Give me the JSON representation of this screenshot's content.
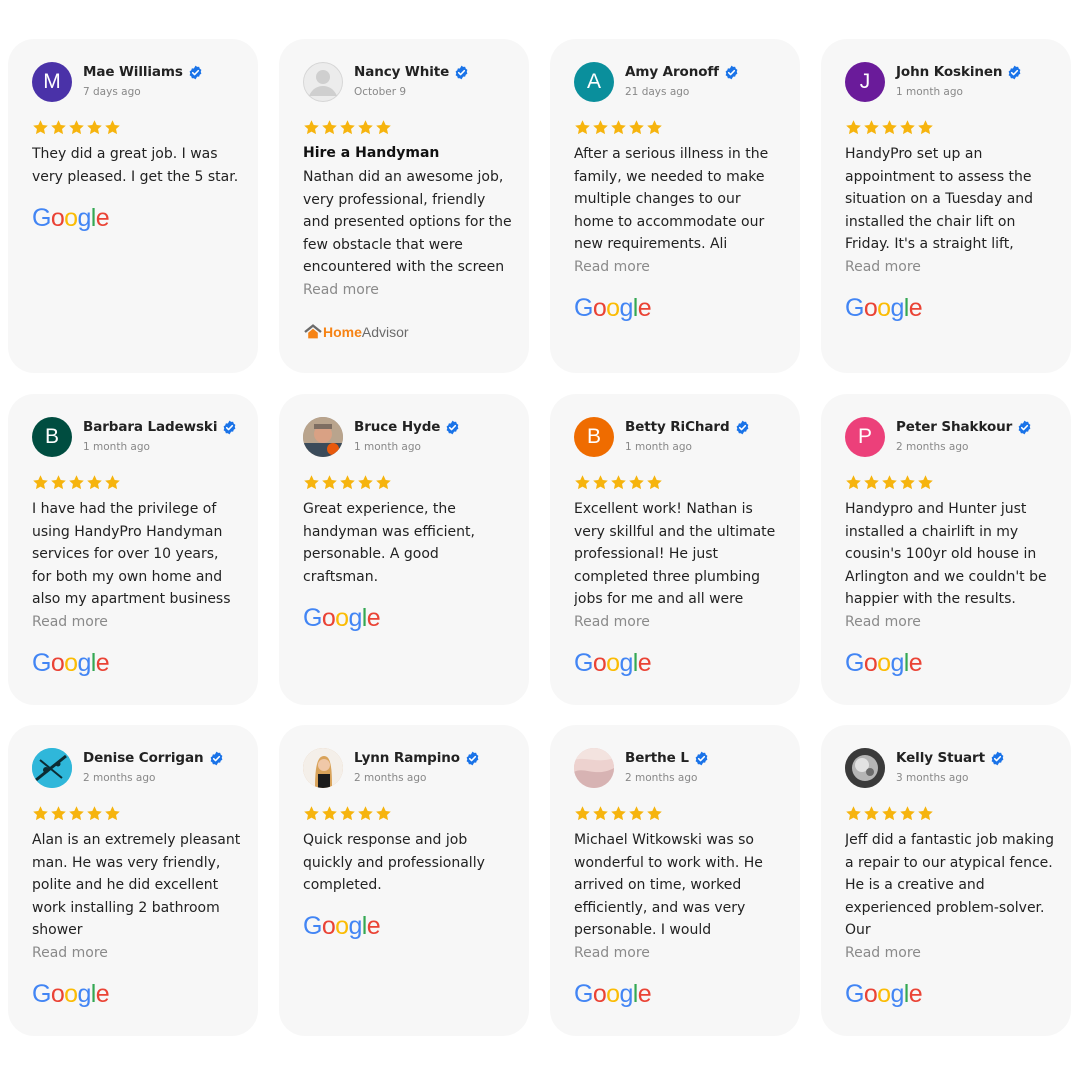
{
  "reviews": [
    {
      "name": "Mae Williams",
      "date": "7 days ago",
      "initial": "M",
      "avatar_color": "#4a32a8",
      "rating": 5,
      "title": "",
      "text": "They did a great job. I was very pleased. I get the 5 star.",
      "read_more": "",
      "source": "Google",
      "avatar_type": "letter"
    },
    {
      "name": "Nancy White",
      "date": "October 9",
      "initial": "",
      "avatar_color": "#e6e6e6",
      "rating": 5,
      "title": "Hire a Handyman",
      "text": "Nathan did an awesome job, very professional, friendly and presented options for the few obstacle that were encountered with the screen",
      "read_more": "Read more",
      "source": "HomeAdvisor",
      "avatar_type": "placeholder",
      "source_parts": [
        "Home",
        "Advisor"
      ]
    },
    {
      "name": "Amy Aronoff",
      "date": "21 days ago",
      "initial": "A",
      "avatar_color": "#0a8f9c",
      "rating": 5,
      "title": "",
      "text": "After a serious illness in the family, we needed to make multiple changes to our home to accommodate our new requirements. Ali",
      "read_more": "Read more",
      "source": "Google",
      "avatar_type": "letter"
    },
    {
      "name": "John Koskinen",
      "date": "1 month ago",
      "initial": "J",
      "avatar_color": "#6a1b9a",
      "rating": 5,
      "title": "",
      "text": "HandyPro set up an appointment to assess the situation on a Tuesday and installed the chair lift on Friday. It's a straight lift,",
      "read_more": "Read more",
      "source": "Google",
      "avatar_type": "letter"
    },
    {
      "name": "Barbara Ladewski",
      "date": "1 month ago",
      "initial": "B",
      "avatar_color": "#004d40",
      "rating": 5,
      "title": "",
      "text": "I have had the privilege of using HandyPro Handyman services for over 10 years, for both my own home and also my apartment business",
      "read_more": "Read more",
      "source": "Google",
      "avatar_type": "letter"
    },
    {
      "name": "Bruce Hyde",
      "date": "1 month ago",
      "initial": "",
      "avatar_color": "#8a7a6a",
      "rating": 5,
      "title": "",
      "text": "Great experience, the handyman was efficient, personable. A good craftsman.",
      "read_more": "",
      "source": "Google",
      "avatar_type": "photo"
    },
    {
      "name": "Betty RiChard",
      "date": "1 month ago",
      "initial": "B",
      "avatar_color": "#ef6c00",
      "rating": 5,
      "title": "",
      "text": "Excellent work! Nathan is very skillful and the ultimate professional! He just completed three plumbing jobs for me and all were",
      "read_more": "Read more",
      "source": "Google",
      "avatar_type": "letter"
    },
    {
      "name": "Peter Shakkour",
      "date": "2 months ago",
      "initial": "P",
      "avatar_color": "#ec407a",
      "rating": 5,
      "title": "",
      "text": "Handypro and Hunter just installed a chairlift in my cousin's 100yr old house in Arlington and we couldn't be happier with the results.",
      "read_more": "Read more",
      "source": "Google",
      "avatar_type": "letter"
    },
    {
      "name": "Denise Corrigan",
      "date": "2 months ago",
      "initial": "",
      "avatar_color": "#29b6d8",
      "rating": 5,
      "title": "",
      "text": "Alan is an extremely pleasant man. He was very friendly, polite and he did excellent work installing 2 bathroom shower",
      "read_more": "Read more",
      "source": "Google",
      "avatar_type": "photo"
    },
    {
      "name": "Lynn Rampino",
      "date": "2 months ago",
      "initial": "",
      "avatar_color": "#d9b38c",
      "rating": 5,
      "title": "",
      "text": "Quick response and job quickly and professionally completed.",
      "read_more": "",
      "source": "Google",
      "avatar_type": "photo"
    },
    {
      "name": "Berthe L",
      "date": "2 months ago",
      "initial": "",
      "avatar_color": "#e7c3c3",
      "rating": 5,
      "title": "",
      "text": "Michael Witkowski was so wonderful to work with. He arrived on time, worked efficiently, and was very personable. I would",
      "read_more": "Read more",
      "source": "Google",
      "avatar_type": "photo"
    },
    {
      "name": "Kelly Stuart",
      "date": "3 months ago",
      "initial": "",
      "avatar_color": "#9e9e9e",
      "rating": 5,
      "title": "",
      "text": "Jeff did a fantastic job making a repair to our atypical fence. He is a creative and experienced problem-solver. Our",
      "read_more": "Read more",
      "source": "Google",
      "avatar_type": "photo"
    }
  ],
  "google_letters": [
    "G",
    "o",
    "o",
    "g",
    "l",
    "e"
  ],
  "colors": {
    "star": "#f6b40e",
    "verified": "#1a73e8",
    "card_bg": "#f7f7f7"
  },
  "icons": {
    "star": "star-icon",
    "verified": "verified-badge-icon",
    "google": "google-logo",
    "homeadvisor": "homeadvisor-logo"
  }
}
